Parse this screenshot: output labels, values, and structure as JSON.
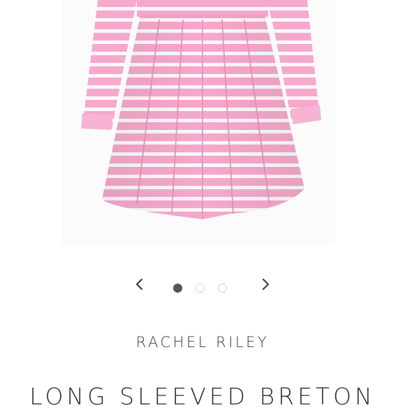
{
  "product": {
    "brand": "RACHEL RILEY",
    "title": "LONG SLEEVED BRETON",
    "image_alt": "pink and white striped long sleeved dress"
  },
  "carousel": {
    "prev_icon": "chevron-left-icon",
    "next_icon": "chevron-right-icon",
    "dots": [
      {
        "active": true
      },
      {
        "active": false
      },
      {
        "active": false
      }
    ]
  },
  "colors": {
    "dress_pink": "#f5a9cc",
    "stripe_white": "#ffffff",
    "text": "#333333",
    "dot_active": "#555555",
    "dot_inactive_border": "#cfcfcf"
  }
}
